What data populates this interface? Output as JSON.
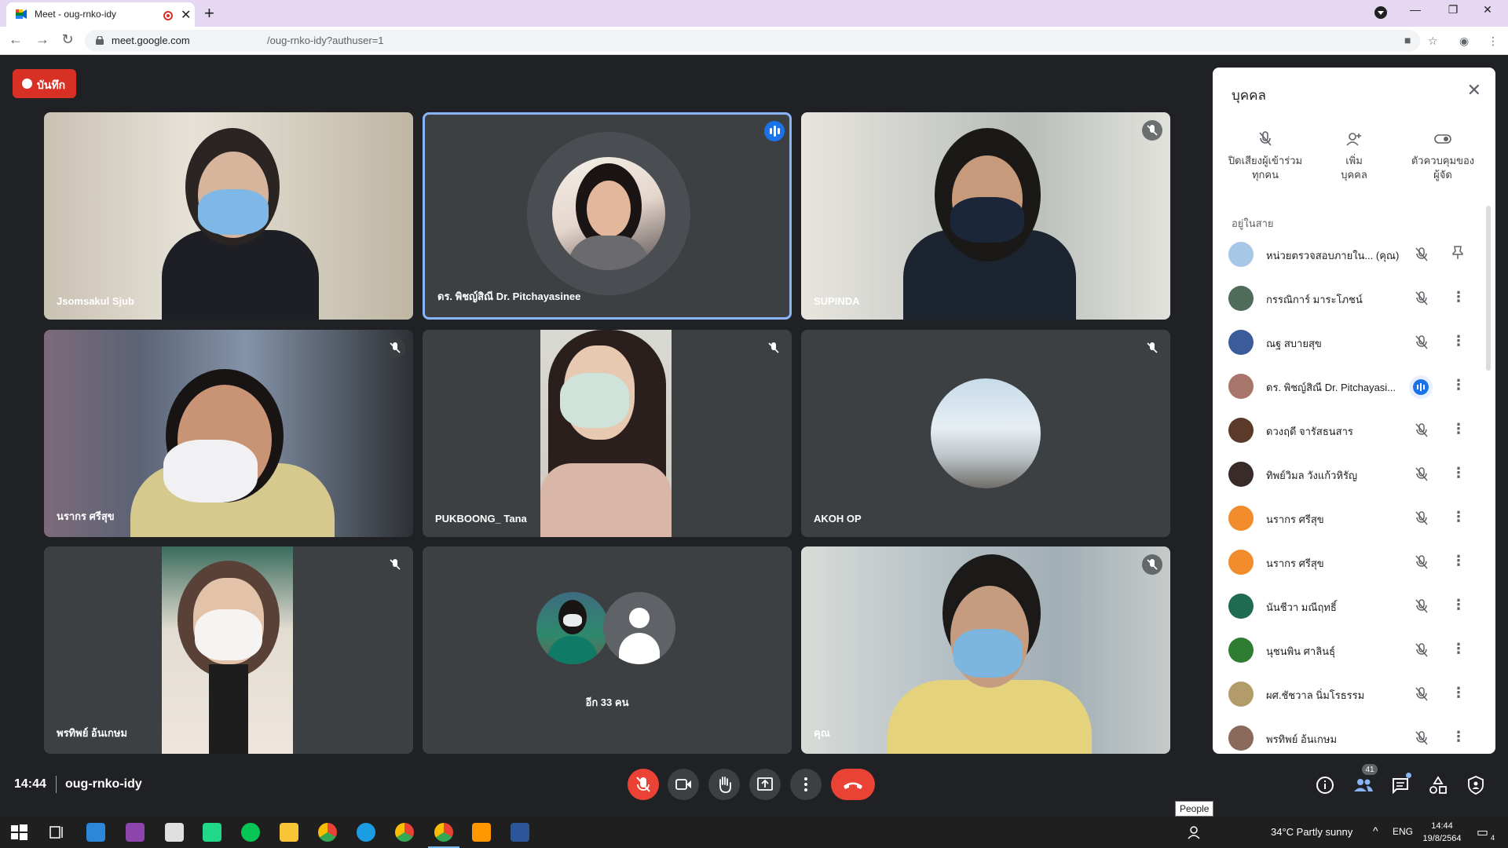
{
  "browser": {
    "tab_title": "Meet - oug-rnko-idy",
    "url_host": "meet.google.com",
    "url_path": "/oug-rnko-idy?authuser=1"
  },
  "meet": {
    "record_label": "บันทึก",
    "time": "14:44",
    "meeting_code": "oug-rnko-idy",
    "tiles": [
      {
        "name": "Jsomsakul Sjub"
      },
      {
        "name": "ดร. พิชญ์สิณี Dr. Pitchayasinee"
      },
      {
        "name": "SUPINDA"
      },
      {
        "name": "นรากร ศรีสุข"
      },
      {
        "name": "PUKBOONG_ Tana"
      },
      {
        "name": "AKOH OP"
      },
      {
        "name": "พรทิพย์ อ้นเกษม"
      },
      {
        "name": "อีก 33 คน"
      },
      {
        "name": "คุณ"
      }
    ],
    "people_count_badge": "41",
    "tooltip": "People"
  },
  "panel": {
    "title": "บุคคล",
    "actions": [
      {
        "label": "ปิดเสียงผู้เข้าร่วมทุกคน",
        "line1": "ปิดเสียงผู้เข้าร่วม",
        "line2": "ทุกคน"
      },
      {
        "label": "เพิ่มบุคคล",
        "line1": "เพิ่ม",
        "line2": "บุคคล"
      },
      {
        "label": "ตัวควบคุมของผู้จัด",
        "line1": "ตัวควบคุมของ",
        "line2": "ผู้จัด"
      }
    ],
    "in_call_label": "อยู่ในสาย",
    "participants": [
      {
        "name": "หน่วยตรวจสอบภายใน... (คุณ)",
        "color": "#a7c7e7"
      },
      {
        "name": "กรรณิการ์ มาระโภชน์",
        "color": "#4f6b5a"
      },
      {
        "name": "ณฐ สบายสุข",
        "color": "#3b5b9b"
      },
      {
        "name": "ดร. พิชญ์สิณี Dr. Pitchayasi...",
        "color": "#a8756a"
      },
      {
        "name": "ดวงฤดี จารัสธนสาร",
        "color": "#5b3a2a"
      },
      {
        "name": "ทิพย์วิมล วังแก้วหิรัญ",
        "color": "#3a2b2b"
      },
      {
        "name": "นรากร ศรีสุข",
        "color": "#f28b2c"
      },
      {
        "name": "นรากร ศรีสุข",
        "color": "#f28b2c"
      },
      {
        "name": "นันชีวา มณีฤทธิ์",
        "color": "#1e6b52"
      },
      {
        "name": "นุชนพิน ศาลินธุ์",
        "color": "#2e7d32"
      },
      {
        "name": "ผศ.ชัชวาล นิ่มโรธรรม",
        "color": "#b39b6a"
      },
      {
        "name": "พรทิพย์ อ้นเกษม",
        "color": "#8a6a5a"
      }
    ]
  },
  "taskbar": {
    "weather": "34°C  Partly sunny",
    "lang": "ENG",
    "time": "14:44",
    "date": "19/8/2564",
    "notif_count": "4"
  }
}
